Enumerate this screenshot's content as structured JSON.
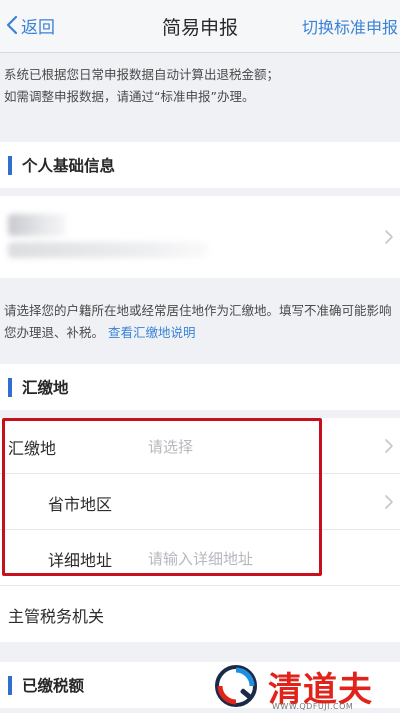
{
  "nav": {
    "back_label": "返回",
    "title": "简易申报",
    "switch_label": "切换标准申报"
  },
  "notice": {
    "line1": "系统已根据您日常申报数据自动计算出退税金额；",
    "line2": "如需调整申报数据，请通过“标准申报”办理。"
  },
  "personal_section": {
    "title": "个人基础信息"
  },
  "payment_hint": {
    "text": "请选择您的户籍所在地或经常居住地作为汇缴地。填写不准确可能影响您办理退、补税。",
    "link": "查看汇缴地说明"
  },
  "payment_section": {
    "title": "汇缴地",
    "rows": [
      {
        "label": "汇缴地",
        "value": "请选择"
      },
      {
        "label": "省市地区",
        "value": ""
      },
      {
        "label": "详细地址",
        "value": "请输入详细地址"
      }
    ]
  },
  "tax_authority_row": {
    "label": "主管税务机关"
  },
  "paid_section": {
    "title": "已缴税额"
  },
  "watermark": {
    "brand": "清道夫",
    "url": "WWW.QDFUJI.COM"
  },
  "colors": {
    "accent_blue": "#3a82d6",
    "section_bar": "#2f6fcf",
    "highlight_red": "#c8101c",
    "page_bg": "#eff1f5"
  }
}
